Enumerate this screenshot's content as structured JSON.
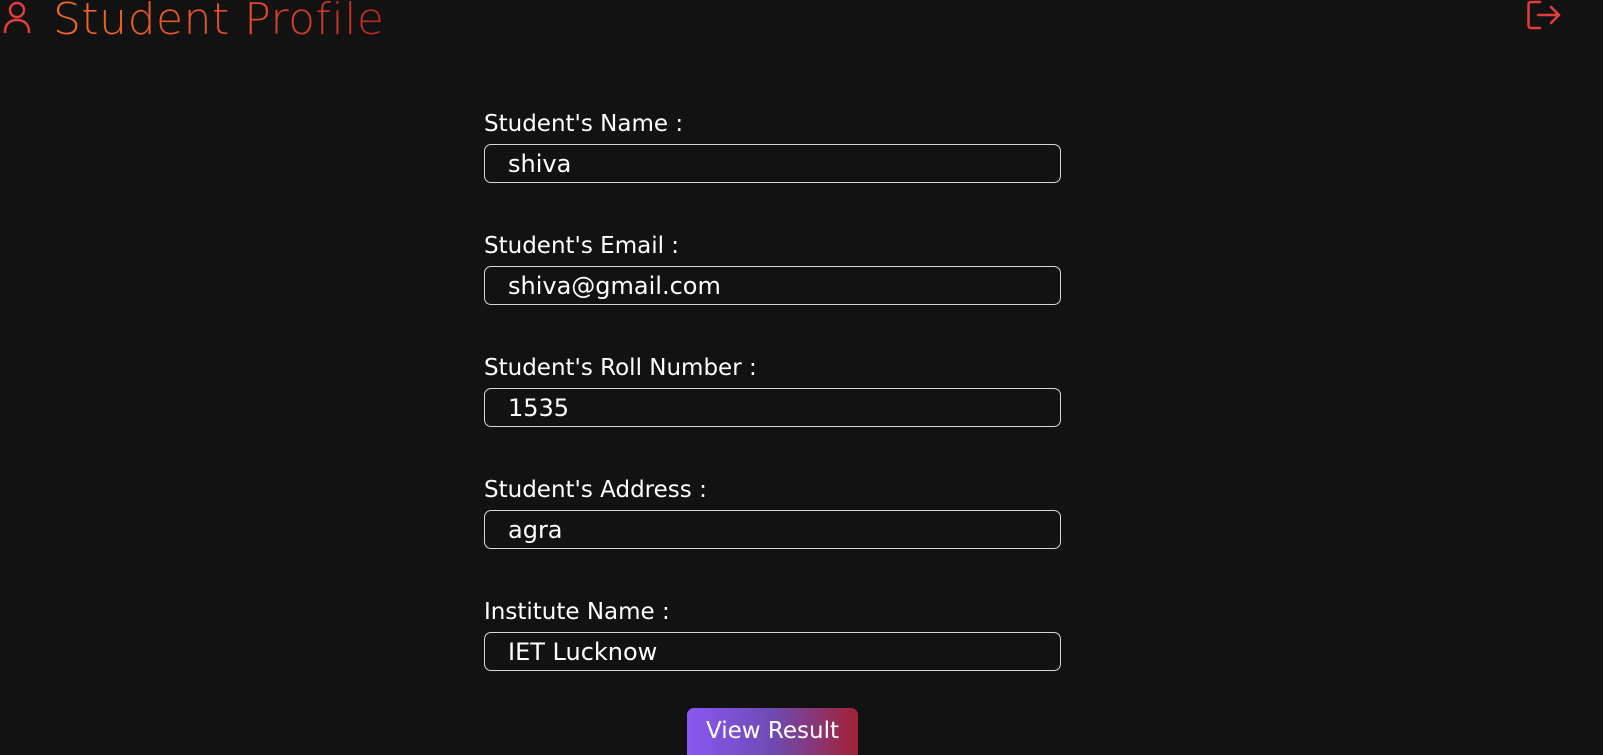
{
  "header": {
    "title": "Student Profile",
    "user_icon": "user-icon",
    "logout_icon": "logout-icon",
    "accent_color": "#f26a24",
    "icon_color": "#e23d3d"
  },
  "form": {
    "fields": [
      {
        "label": "Student's Name :",
        "value": "shiva"
      },
      {
        "label": "Student's Email :",
        "value": "shiva@gmail.com"
      },
      {
        "label": "Student's Roll Number :",
        "value": "1535"
      },
      {
        "label": "Student's Address :",
        "value": "agra"
      },
      {
        "label": "Institute Name :",
        "value": "IET Lucknow"
      }
    ]
  },
  "actions": {
    "view_result_label": "View Result"
  }
}
